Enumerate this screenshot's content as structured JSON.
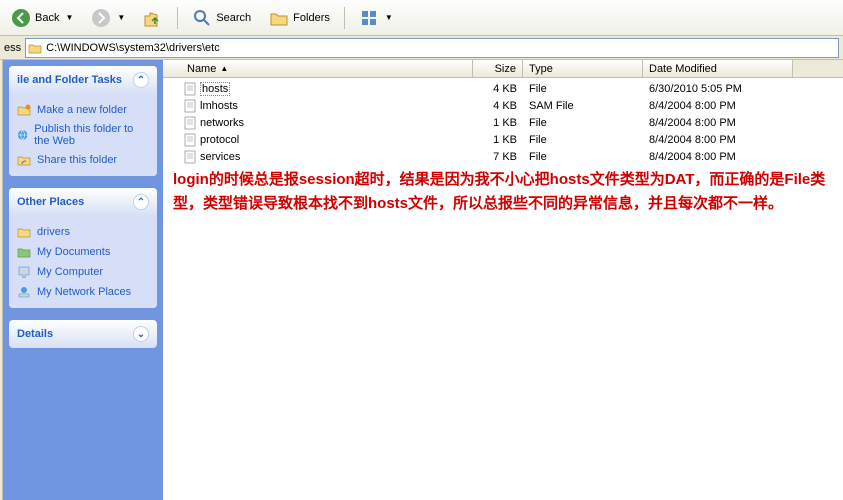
{
  "toolbar": {
    "back": "Back",
    "search": "Search",
    "folders": "Folders"
  },
  "address": {
    "label": "ess",
    "path": "C:\\WINDOWS\\system32\\drivers\\etc"
  },
  "columns": {
    "name": "Name",
    "size": "Size",
    "type": "Type",
    "date": "Date Modified"
  },
  "files": [
    {
      "name": "hosts",
      "size": "4 KB",
      "type": "File",
      "date": "6/30/2010 5:05 PM",
      "sel": true
    },
    {
      "name": "lmhosts",
      "size": "4 KB",
      "type": "SAM File",
      "date": "8/4/2004 8:00 PM",
      "sel": false
    },
    {
      "name": "networks",
      "size": "1 KB",
      "type": "File",
      "date": "8/4/2004 8:00 PM",
      "sel": false
    },
    {
      "name": "protocol",
      "size": "1 KB",
      "type": "File",
      "date": "8/4/2004 8:00 PM",
      "sel": false
    },
    {
      "name": "services",
      "size": "7 KB",
      "type": "File",
      "date": "8/4/2004 8:00 PM",
      "sel": false
    }
  ],
  "panels": {
    "tasks": {
      "title": "ile and Folder Tasks",
      "items": [
        "Make a new folder",
        "Publish this folder to the Web",
        "Share this folder"
      ]
    },
    "places": {
      "title": "Other Places",
      "items": [
        "drivers",
        "My Documents",
        "My Computer",
        "My Network Places"
      ]
    },
    "details": {
      "title": "Details"
    }
  },
  "annotation": "login的时候总是报session超时，结果是因为我不小心把hosts文件类型为DAT，而正确的是File类型，类型错误导致根本找不到hosts文件，所以总报些不同的异常信息，并且每次都不一样。"
}
